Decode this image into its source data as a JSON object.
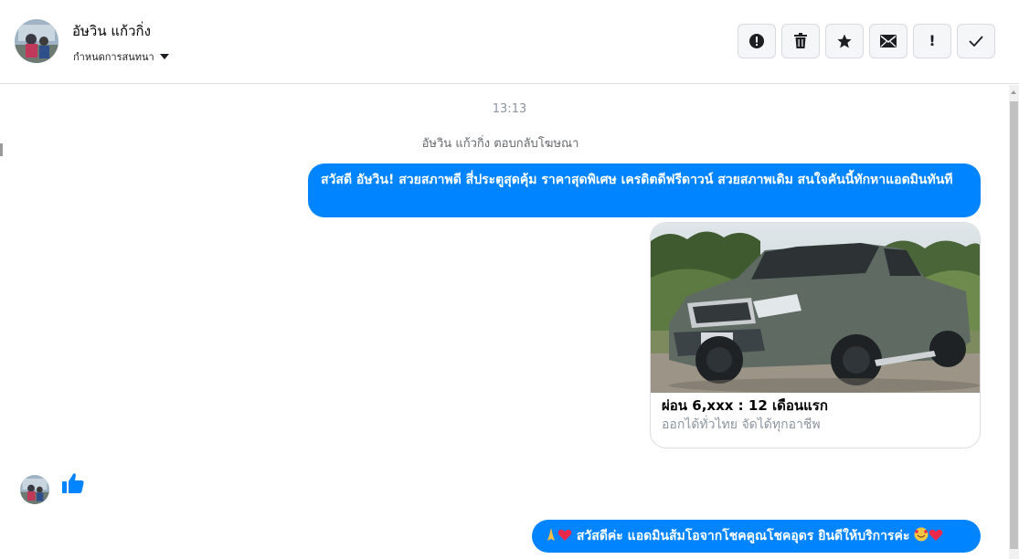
{
  "header": {
    "contact_name": "อัษวิน แก้วกิ่ง",
    "assign_label": "กำหนดการสนทนา",
    "actions": [
      {
        "icon": "exclamation-circle-icon"
      },
      {
        "icon": "trash-icon"
      },
      {
        "icon": "star-icon"
      },
      {
        "icon": "envelope-icon"
      },
      {
        "icon": "exclamation-icon"
      },
      {
        "icon": "check-icon"
      }
    ]
  },
  "thread": {
    "timestamp": "13:13",
    "ad_reply_note": "อัษวิน แก้วกิ่ง ตอบกลับโฆษณา",
    "message_1": "สวัสดี อัษวิน! สวยสภาพดี สี่ประตูสุดคุ้ม ราคาสุดพิเศษ เครดิตดีฟรีดาวน์ สวยสภาพเดิม สนใจคันนี้ทักหาแอดมินทันที",
    "ad_card": {
      "title": "ผ่อน 6,xxx : 12 เดือนแรก",
      "subtitle": "ออกได้ทั่วไทย จัดได้ทุกอาชีพ"
    },
    "message_2": "สวัสดีค่ะ แอดมินส้มโอจากโชคคูณโชคอุดร ยินดีให้บริการค่ะ"
  },
  "colors": {
    "messenger_blue": "#0084ff",
    "border": "#dddfe2",
    "muted_text": "#8d949e"
  }
}
